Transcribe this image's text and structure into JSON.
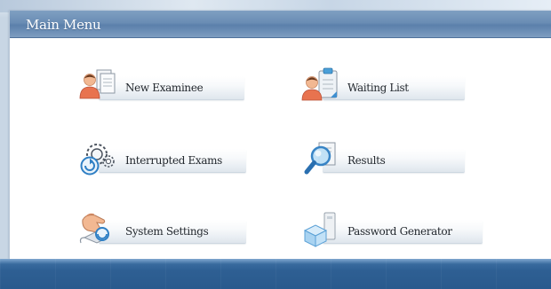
{
  "panel": {
    "title": "Main Menu"
  },
  "menu": {
    "new_examinee": {
      "label": "New Examinee",
      "icon": "person-documents-icon"
    },
    "waiting_list": {
      "label": "Waiting List",
      "icon": "person-clipboard-icon"
    },
    "interrupted_exams": {
      "label": "Interrupted Exams",
      "icon": "gears-refresh-icon"
    },
    "results": {
      "label": "Results",
      "icon": "magnifier-report-icon"
    },
    "system_settings": {
      "label": "System Settings",
      "icon": "hand-settings-icon"
    },
    "password_generator": {
      "label": "Password Generator",
      "icon": "box-key-icon"
    }
  },
  "colors": {
    "header": "#6a8db4",
    "bottom_band": "#2e5f93",
    "button_face": "#eef2f6"
  }
}
